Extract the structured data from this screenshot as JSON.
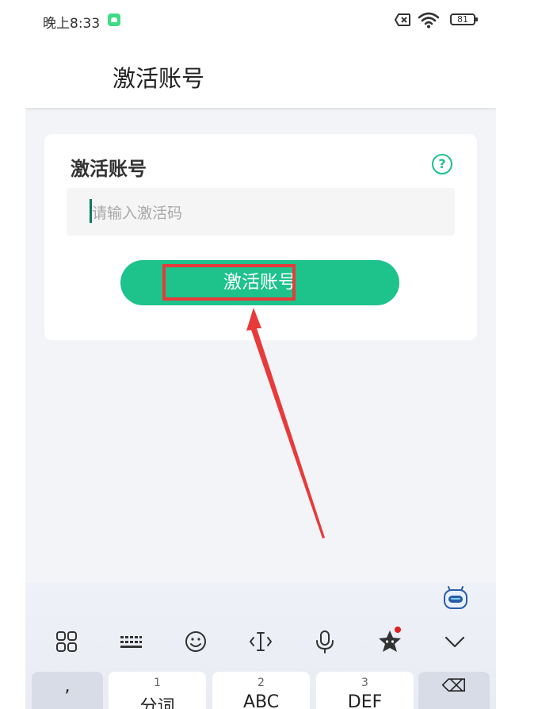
{
  "status_bar": {
    "time": "晚上8:33",
    "battery": "81",
    "icons": [
      "android-icon",
      "sim-off-icon",
      "wifi-icon",
      "battery-icon"
    ]
  },
  "app_bar": {
    "title": "激活账号"
  },
  "card": {
    "title": "激活账号",
    "help_icon_glyph": "?",
    "input": {
      "value": "",
      "placeholder": "请输入激活码"
    },
    "button_label": "激活账号"
  },
  "keyboard": {
    "toolbar_icons": [
      "grid-apps-icon",
      "keyboard-icon",
      "emoji-icon",
      "cursor-icon",
      "microphone-icon",
      "ad-star-icon",
      "chevron-down-icon"
    ],
    "keys": [
      {
        "num": "",
        "label": ","
      },
      {
        "num": "1",
        "label": "分词"
      },
      {
        "num": "2",
        "label": "ABC"
      },
      {
        "num": "3",
        "label": "DEF"
      },
      {
        "num": "",
        "label": "⌫"
      }
    ]
  },
  "colors": {
    "accent": "#1ec28b",
    "annotation": "#e83a3a",
    "background": "#f3f4f8"
  }
}
